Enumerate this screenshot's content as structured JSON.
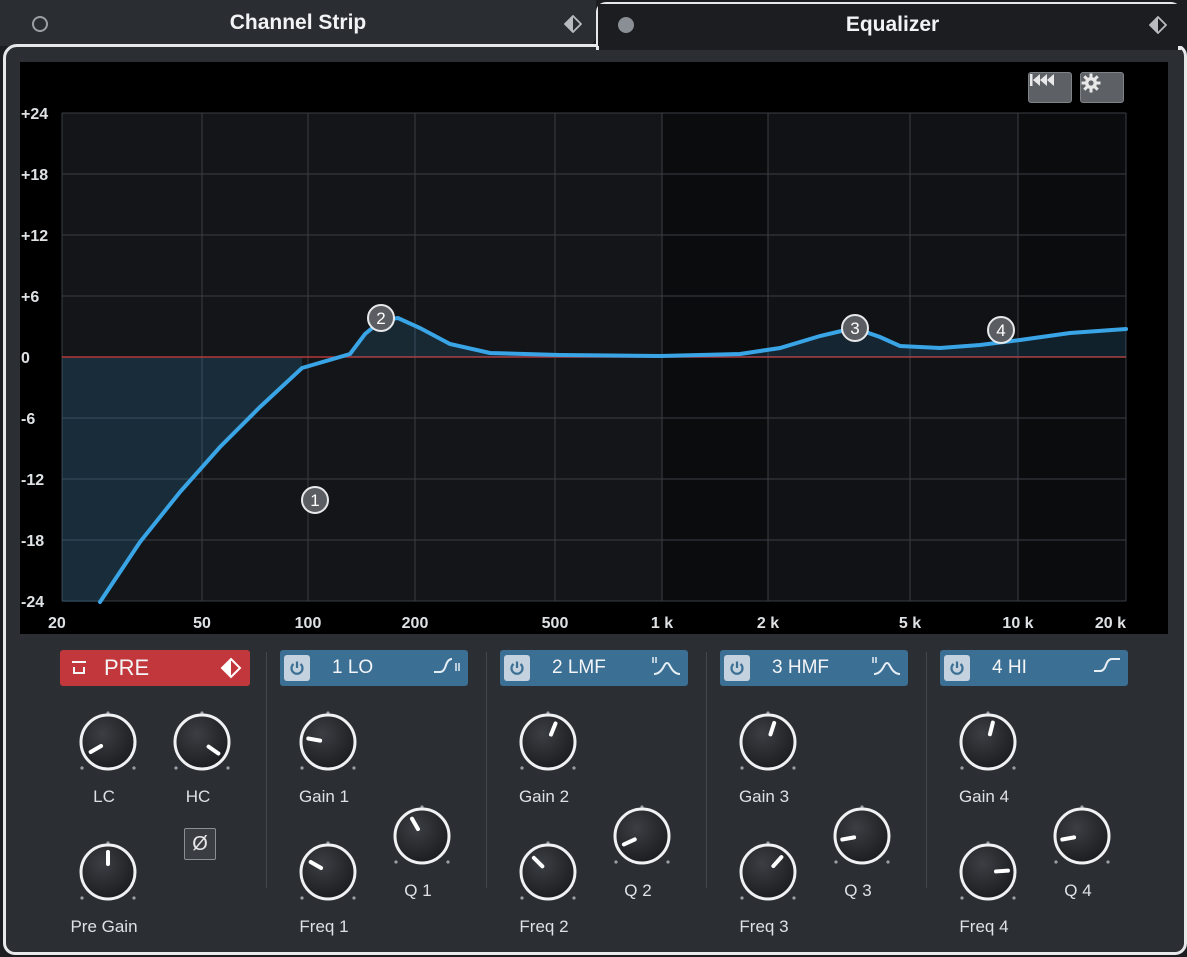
{
  "tabs": [
    {
      "label": "Channel Strip",
      "active": false
    },
    {
      "label": "Equalizer",
      "active": true
    }
  ],
  "graph": {
    "db_labels": [
      "+24",
      "+18",
      "+12",
      "+6",
      "0",
      "-6",
      "-12",
      "-18",
      "-24"
    ],
    "freq_labels": [
      "20",
      "50",
      "100",
      "200",
      "500",
      "1 k",
      "2 k",
      "5 k",
      "10 k",
      "20 k"
    ],
    "band_markers": [
      "1",
      "2",
      "3",
      "4"
    ],
    "buttons": {
      "reset_icon": "skip-back-icon",
      "settings_icon": "gear-icon"
    },
    "curve_color": "#3aa5e6"
  },
  "pre": {
    "label": "PRE",
    "knobs": {
      "lc": "LC",
      "hc": "HC",
      "pre_gain": "Pre Gain"
    },
    "phase_symbol": "Ø",
    "color": "#c1373b"
  },
  "bands": [
    {
      "label": "1 LO",
      "gain": "Gain 1",
      "freq": "Freq 1",
      "q": "Q 1",
      "filter_icon": "low-shelf-icon"
    },
    {
      "label": "2 LMF",
      "gain": "Gain 2",
      "freq": "Freq 2",
      "q": "Q 2",
      "filter_icon": "peak-icon"
    },
    {
      "label": "3 HMF",
      "gain": "Gain 3",
      "freq": "Freq 3",
      "q": "Q 3",
      "filter_icon": "peak-icon"
    },
    {
      "label": "4 HI",
      "gain": "Gain 4",
      "freq": "Freq 4",
      "q": "Q 4",
      "filter_icon": "high-shelf-icon"
    }
  ],
  "band_color": "#3b6f94"
}
